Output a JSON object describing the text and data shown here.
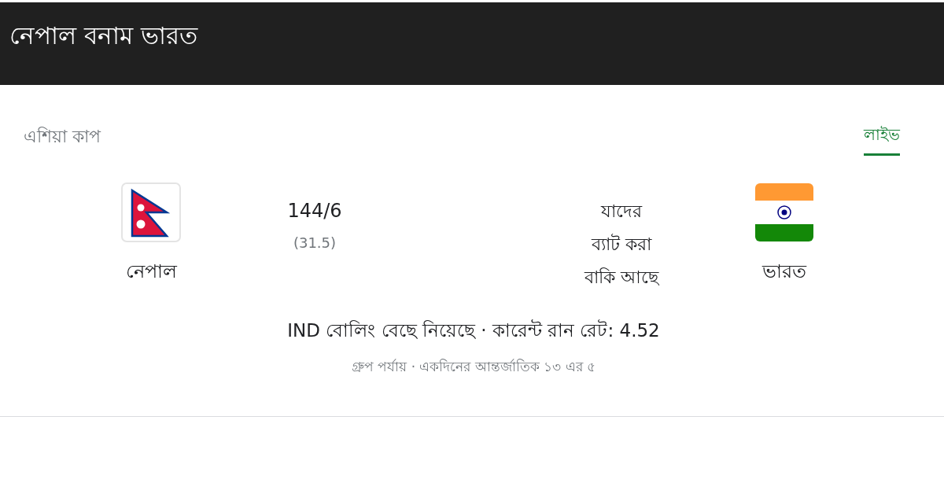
{
  "header": {
    "title": "নেপাল বনাম ভারত"
  },
  "tournament": "এশিয়া কাপ",
  "live": "লাইভ",
  "home_team": {
    "name": "নেপাল",
    "score": "144/6",
    "overs": "(31.5)"
  },
  "status": [
    "যাদের",
    "ব্যাট করা",
    "বাকি আছে"
  ],
  "away_team": {
    "name": "ভারত"
  },
  "summary": "IND বোলিং বেছে নিয়েছে · কারেন্ট রান রেট: 4.52",
  "details": "গ্রুপ পর্যায় · একদিনের আন্তর্জাতিক ১৩ এর ৫"
}
